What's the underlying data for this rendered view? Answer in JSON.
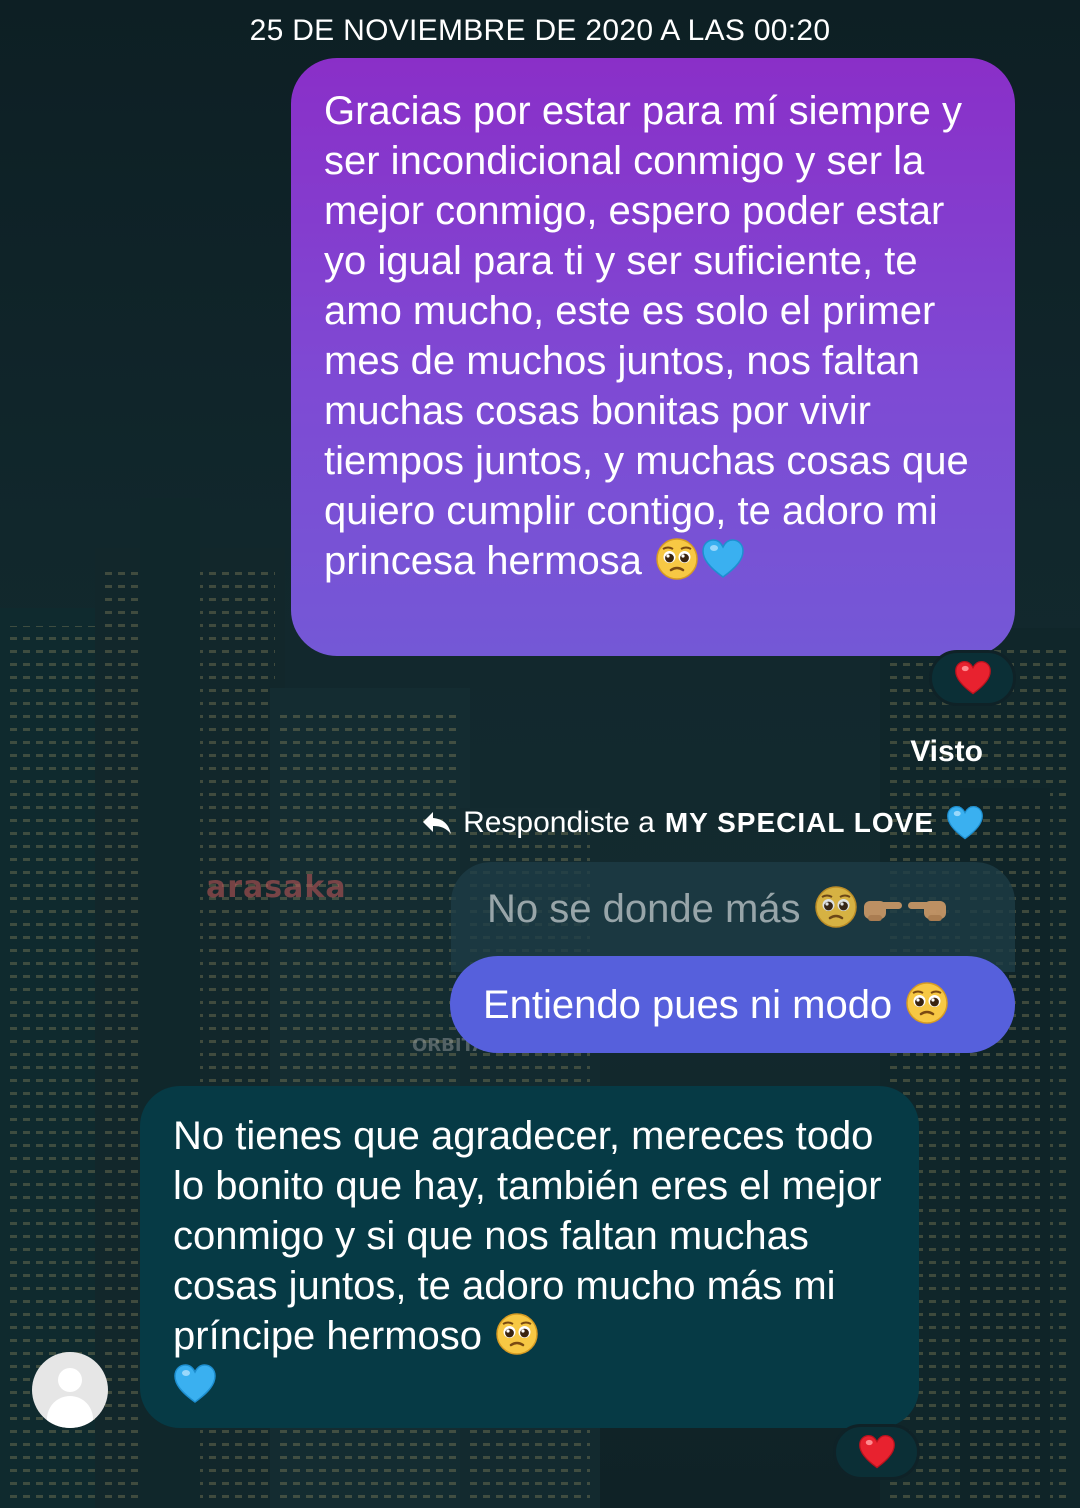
{
  "conversation": {
    "timestamp": "25 DE NOVIEMBRE DE 2020 A LAS 00:20",
    "messages": [
      {
        "direction": "outgoing",
        "text": "Gracias por estar para mí siempre y ser incondicional conmigo y ser la mejor conmigo, espero poder estar yo igual para ti y ser suficiente, te amo mucho, este es solo el primer mes de muchos juntos, nos faltan muchas cosas bonitas por vivir tiempos juntos, y muchas cosas que quiero cumplir contigo, te adoro mi princesa hermosa",
        "emojis": [
          "pleading-face",
          "blue-heart"
        ],
        "reaction": "red-heart",
        "bubble_color": "#8a2fc8"
      },
      {
        "direction": "outgoing",
        "seen_label": "Visto",
        "reply_prefix": "Respondiste a",
        "reply_to_name": "MY SPECIAL LOVE",
        "reply_to_emoji": "blue-heart",
        "quoted_text": "No se donde más",
        "quoted_emojis": [
          "pleading-face",
          "pointing-right",
          "pointing-left"
        ],
        "text": "Entiendo pues ni modo",
        "emojis": [
          "pleading-face"
        ],
        "bubble_color": "#5660dc"
      },
      {
        "direction": "incoming",
        "text": "No tienes que agradecer, mereces todo lo bonito que hay, también eres el mejor conmigo y si que nos faltan muchas cosas juntos, te adoro mucho más mi príncipe hermoso",
        "emojis": [
          "pleading-face",
          "blue-heart"
        ],
        "reaction": "red-heart",
        "bubble_color": "#063a45"
      }
    ]
  },
  "background": {
    "sign_text": "arasaka",
    "sign_small": "ORBITAL AIR"
  }
}
